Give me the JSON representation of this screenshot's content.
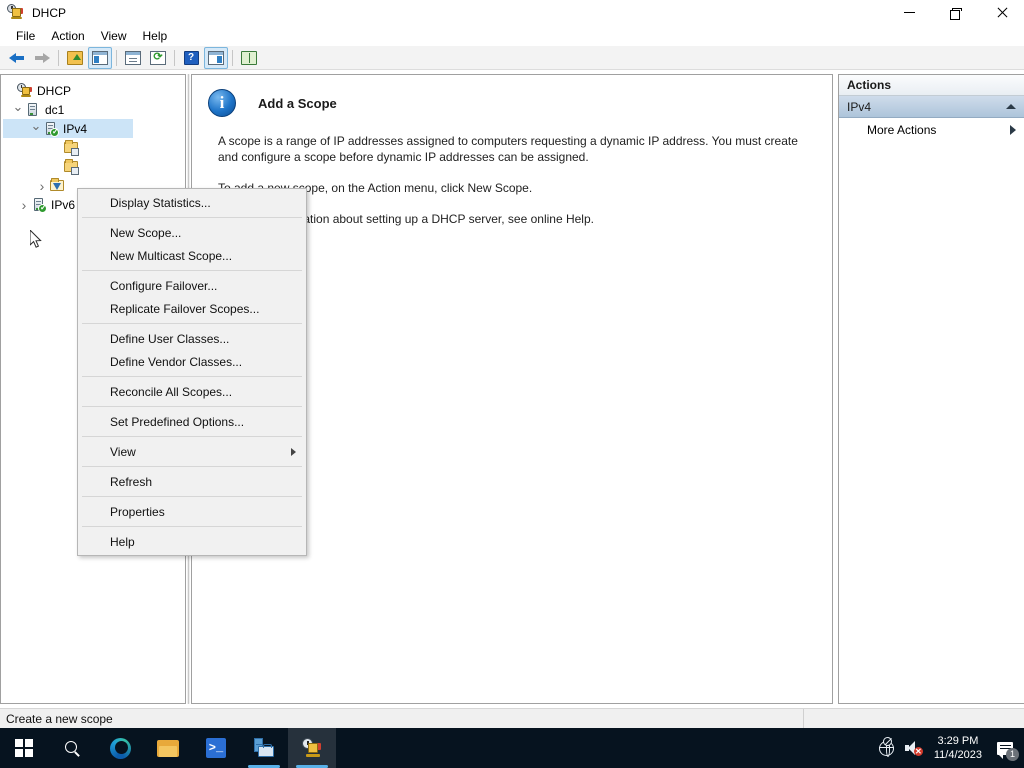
{
  "window": {
    "title": "DHCP",
    "icon": "dhcp-icon",
    "minimize_label": "Minimize",
    "maximize_label": "Restore",
    "close_label": "Close"
  },
  "menubar": {
    "items": [
      {
        "label": "File"
      },
      {
        "label": "Action"
      },
      {
        "label": "View"
      },
      {
        "label": "Help"
      }
    ]
  },
  "toolbar": {
    "buttons": [
      {
        "name": "back-button",
        "icon": "arrow-left-icon"
      },
      {
        "name": "forward-button",
        "icon": "arrow-right-icon"
      },
      {
        "name": "up-one-level-button",
        "icon": "folder-up-icon"
      },
      {
        "name": "show-hide-console-tree-button",
        "icon": "tree-pane-icon"
      },
      {
        "name": "properties-button",
        "icon": "properties-icon"
      },
      {
        "name": "refresh-button",
        "icon": "refresh-icon"
      },
      {
        "name": "help-button",
        "icon": "help-icon"
      },
      {
        "name": "show-hide-action-pane-button",
        "icon": "action-pane-icon"
      },
      {
        "name": "export-list-button",
        "icon": "book-icon"
      }
    ]
  },
  "tree": {
    "nodes": [
      {
        "label": "DHCP",
        "icon": "dhcp-root-icon",
        "expanded": true,
        "level": 0
      },
      {
        "label": "dc1",
        "icon": "server-icon",
        "expanded": true,
        "level": 1
      },
      {
        "label": "IPv4",
        "icon": "server-ok-icon",
        "expanded": true,
        "level": 2,
        "selected": true
      },
      {
        "label": "",
        "icon": "server-options-folder-icon",
        "level": 3
      },
      {
        "label": "",
        "icon": "policies-folder-icon",
        "level": 3
      },
      {
        "label": "",
        "icon": "filters-folder-icon",
        "level": 3,
        "expandable": true
      },
      {
        "label": "IPv6",
        "icon": "server-ok-icon",
        "level": 2,
        "expandable": true
      }
    ]
  },
  "context_menu": {
    "items": [
      {
        "label": "Display Statistics...",
        "separator_after": true
      },
      {
        "label": "New Scope..."
      },
      {
        "label": "New Multicast Scope...",
        "separator_after": true
      },
      {
        "label": "Configure Failover..."
      },
      {
        "label": "Replicate Failover Scopes...",
        "separator_after": true
      },
      {
        "label": "Define User Classes..."
      },
      {
        "label": "Define Vendor Classes...",
        "separator_after": true
      },
      {
        "label": "Reconcile All Scopes...",
        "separator_after": true
      },
      {
        "label": "Set Predefined Options...",
        "separator_after": true
      },
      {
        "label": "View",
        "submenu": true,
        "separator_after": true
      },
      {
        "label": "Refresh",
        "separator_after": true
      },
      {
        "label": "Properties",
        "separator_after": true
      },
      {
        "label": "Help"
      }
    ]
  },
  "content": {
    "icon": "info-icon",
    "info_glyph": "i",
    "title": "Add a Scope",
    "paragraphs": [
      "A scope is a range of IP addresses assigned to computers requesting a dynamic IP address. You must create and configure a scope before dynamic IP addresses can be assigned.",
      "To add a new scope, on the Action menu, click New Scope.",
      "For more information about setting up a DHCP server, see online Help."
    ]
  },
  "actions_pane": {
    "header": "Actions",
    "section": {
      "label": "IPv4",
      "collapse_icon": "caret-up-icon"
    },
    "items": [
      {
        "label": "More Actions",
        "submenu_icon": "caret-right-icon"
      }
    ]
  },
  "statusbar": {
    "text": "Create a new scope"
  },
  "taskbar": {
    "items": [
      {
        "name": "start-button",
        "icon": "windows-logo-icon",
        "label": "Start"
      },
      {
        "name": "search-button",
        "icon": "search-icon",
        "label": "Search"
      },
      {
        "name": "edge-button",
        "icon": "edge-icon",
        "label": "Microsoft Edge"
      },
      {
        "name": "file-explorer-button",
        "icon": "folder-icon",
        "label": "File Explorer"
      },
      {
        "name": "powershell-button",
        "icon": "powershell-icon",
        "label": "Windows PowerShell"
      },
      {
        "name": "server-manager-button",
        "icon": "server-manager-icon",
        "label": "Server Manager"
      },
      {
        "name": "dhcp-taskbar-button",
        "icon": "dhcp-icon",
        "label": "DHCP"
      }
    ],
    "tray": {
      "network_icon": "network-disconnected-icon",
      "volume_icon": "speaker-muted-icon",
      "time": "3:29 PM",
      "date": "11/4/2023",
      "notifications_icon": "notifications-icon",
      "notifications_count": "1"
    }
  },
  "colors": {
    "selection_blue": "#cce4f7",
    "actions_section": "#adc4da",
    "taskbar": "#06131f",
    "accent": "#2f7fc4"
  }
}
